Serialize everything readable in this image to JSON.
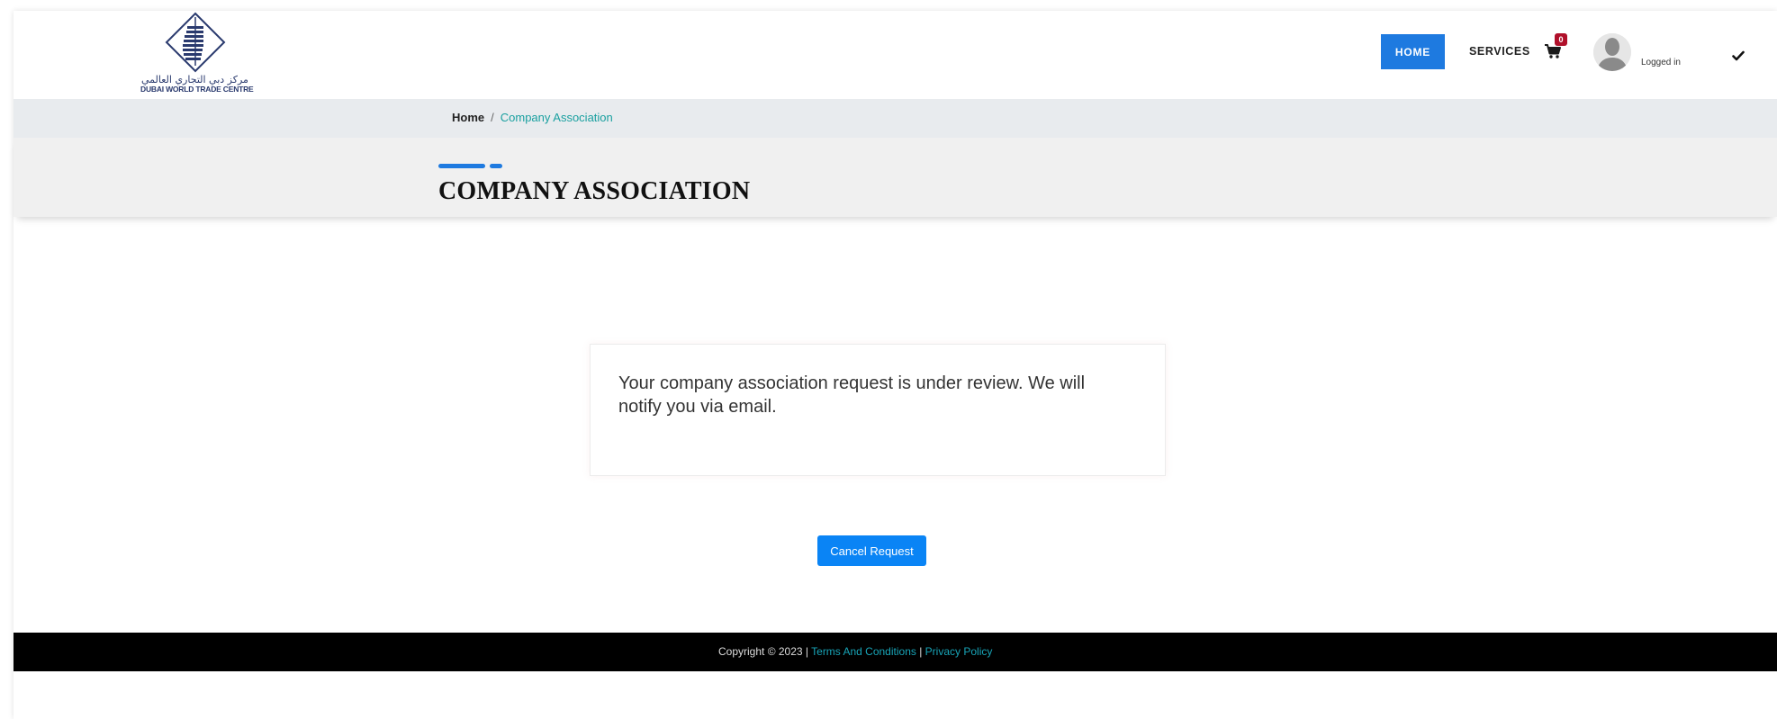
{
  "header": {
    "logo": {
      "arabic_text": "مركز دبي التجاري العالمي",
      "english_text": "DUBAI WORLD TRADE CENTRE"
    },
    "nav": {
      "home_label": "HOME",
      "services_label": "SERVICES"
    },
    "cart": {
      "icon": "cart-icon",
      "count": "0"
    },
    "user": {
      "status_label": "Logged in",
      "dropdown_icon": "checkmark-icon"
    }
  },
  "breadcrumb": {
    "home_label": "Home",
    "separator": "/",
    "current_label": "Company Association"
  },
  "page": {
    "title": "COMPANY ASSOCIATION",
    "accent_color": "#1e7ae0"
  },
  "main": {
    "message": "Your company association request is under review. We will notify you via email.",
    "cancel_button_label": "Cancel Request",
    "cancel_button_color": "#0a84f5"
  },
  "footer": {
    "copyright": "Copyright © 2023 | ",
    "terms_label": "Terms And Conditions",
    "divider": " | ",
    "privacy_label": "Privacy Policy"
  }
}
